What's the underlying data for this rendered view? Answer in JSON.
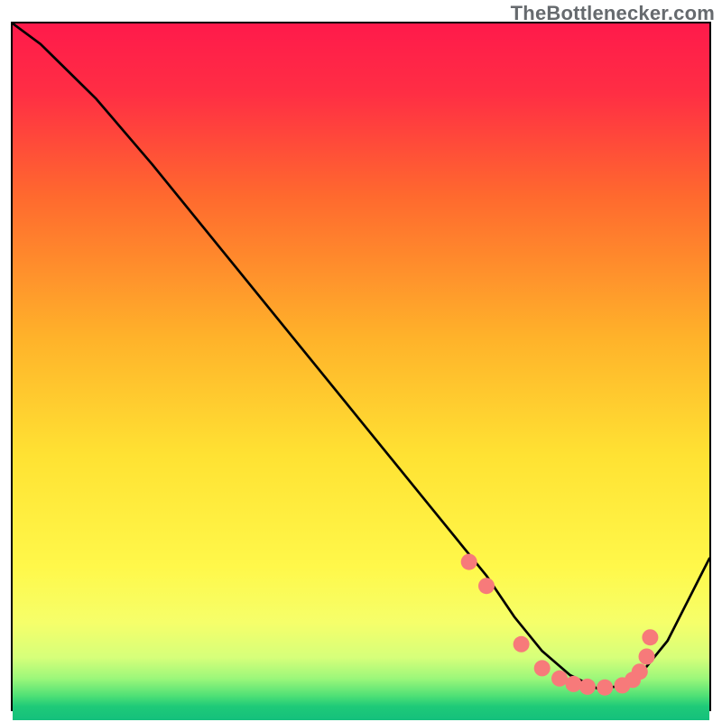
{
  "watermark": "TheBottlenecker.com",
  "chart_data": {
    "type": "line",
    "title": "",
    "xlabel": "",
    "ylabel": "",
    "xlim": [
      0,
      100
    ],
    "ylim": [
      0,
      100
    ],
    "grid": false,
    "background": "vertical gradient red→orange→yellow→green",
    "series": [
      {
        "name": "bottleneck-curve",
        "color": "#000000",
        "x": [
          0,
          4,
          6,
          12,
          20,
          30,
          40,
          50,
          60,
          64,
          68,
          72,
          76,
          80,
          84,
          88,
          90,
          94,
          100
        ],
        "y": [
          100,
          97,
          95,
          89,
          79.5,
          67,
          54.5,
          42,
          29.5,
          24.5,
          19.5,
          13.5,
          8.5,
          5,
          3,
          3.5,
          5,
          10,
          22
        ]
      }
    ],
    "marker_series": {
      "name": "optimal-range-dots",
      "color": "#f77a7a",
      "r": 9,
      "x": [
        65.5,
        68,
        73,
        76,
        78.5,
        80.5,
        82.5,
        85,
        87.5,
        89,
        90,
        91,
        91.5
      ],
      "y": [
        21.5,
        18,
        9.5,
        6,
        4.5,
        3.7,
        3.3,
        3.2,
        3.5,
        4.3,
        5.5,
        7.7,
        10.5
      ]
    }
  }
}
